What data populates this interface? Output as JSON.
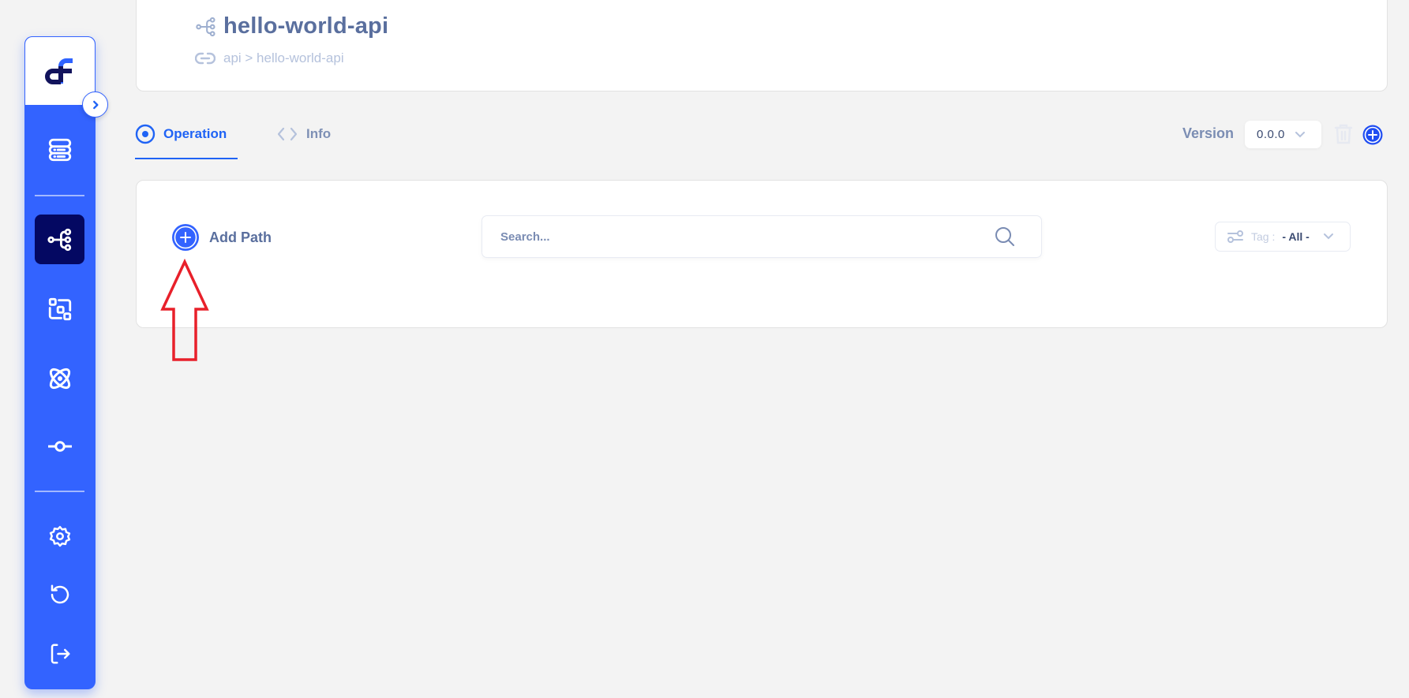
{
  "sidebar": {
    "logo": "app-logo",
    "collapse_icon": "chevron-right-icon",
    "items": [
      {
        "id": "servers",
        "icon": "server-icon",
        "active": false
      },
      {
        "id": "apis",
        "icon": "api-tree-icon",
        "active": true
      },
      {
        "id": "scan",
        "icon": "scan-icon",
        "active": false
      },
      {
        "id": "integrations",
        "icon": "atom-icon",
        "active": false
      },
      {
        "id": "commits",
        "icon": "commit-icon",
        "active": false
      }
    ],
    "bottom_items": [
      {
        "id": "settings",
        "icon": "gear-icon"
      },
      {
        "id": "history",
        "icon": "history-icon"
      },
      {
        "id": "logout",
        "icon": "logout-icon"
      }
    ],
    "colors": {
      "background": "#3363ff",
      "active": "#040862"
    }
  },
  "header": {
    "title": "hello-world-api",
    "title_icon": "api-tree-icon",
    "breadcrumb_icon": "link-icon",
    "breadcrumb": "api > hello-world-api"
  },
  "tabs": [
    {
      "label": "Operation",
      "icon": "radio-target-icon",
      "active": true
    },
    {
      "label": "Info",
      "icon": "code-brackets-icon",
      "active": false
    }
  ],
  "version": {
    "label": "Version",
    "selected": "0.0.0",
    "delete_icon": "trash-icon",
    "add_icon": "plus-circle-icon"
  },
  "operations": {
    "add_path_label": "Add Path",
    "search_placeholder": "Search...",
    "search_value": "",
    "tag_filter_label": "Tag :",
    "tag_filter_value": "- All -"
  },
  "annotation": {
    "type": "arrow",
    "color": "#e8202a",
    "points_to": "add-path-button"
  },
  "colors": {
    "accent": "#1f63f5",
    "text_primary": "#5a6f9e",
    "text_muted": "#b5c2dc",
    "page_bg": "#f3f3f3"
  }
}
